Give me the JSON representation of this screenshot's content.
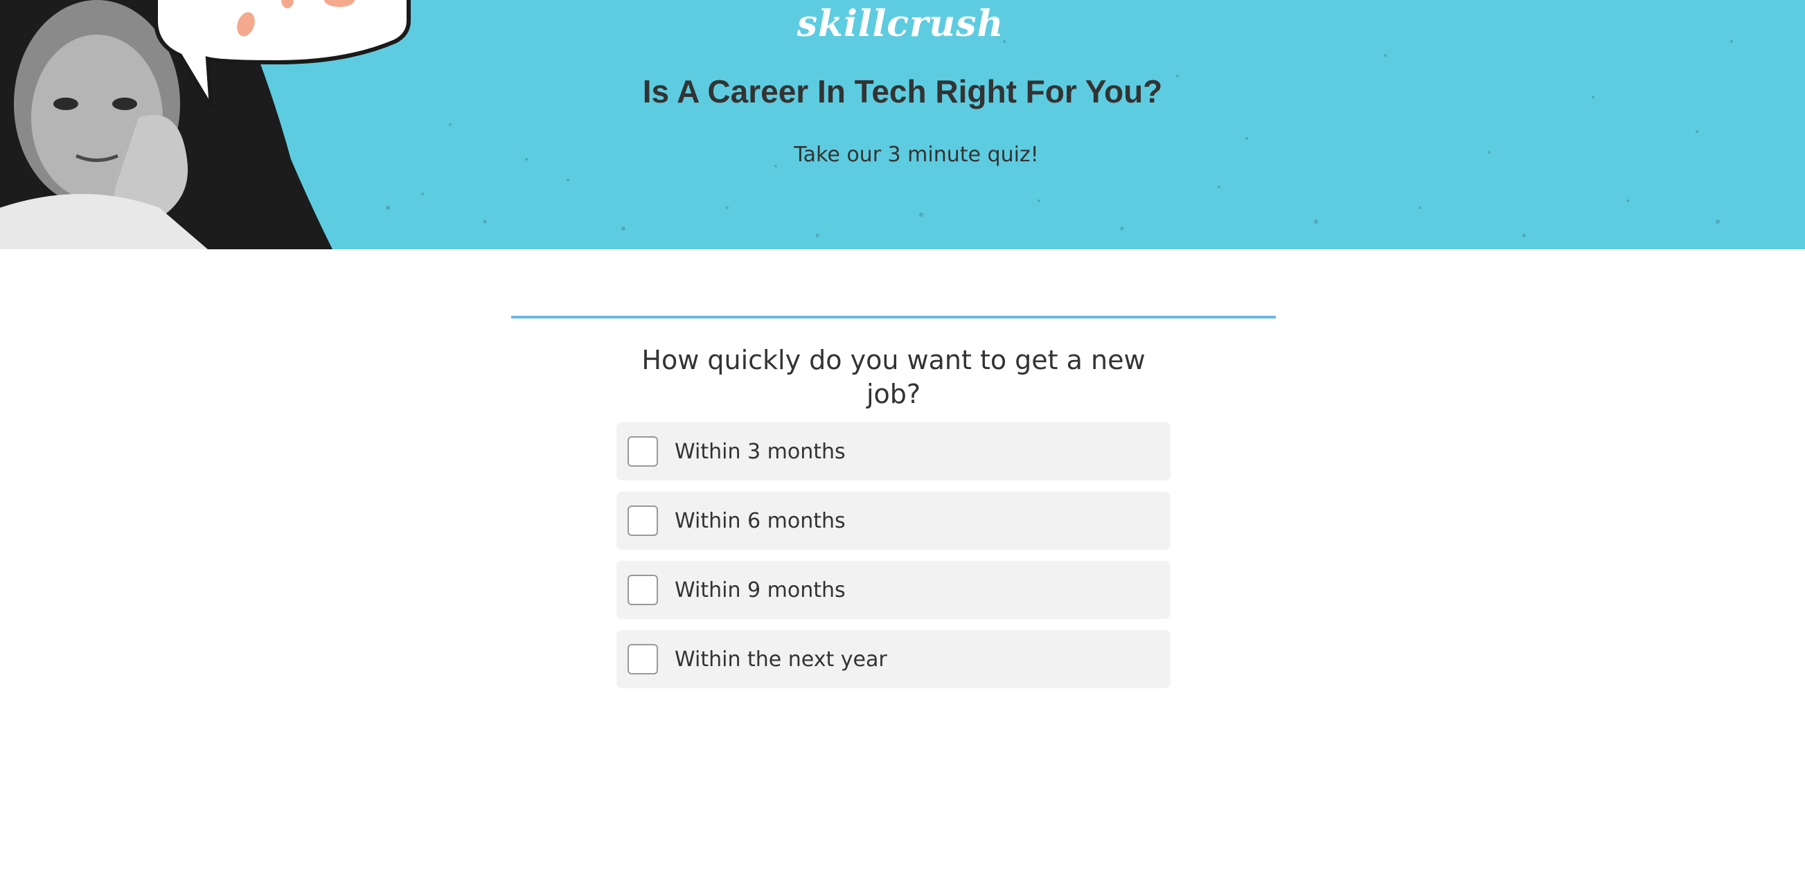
{
  "hero": {
    "logo_text": "skillcrush",
    "title": "Is A Career In Tech Right For You?",
    "subtitle": "Take our 3 minute quiz!"
  },
  "quiz": {
    "progress_fraction": 1.0,
    "question": "How quickly do you want to get a new job?",
    "options": [
      {
        "label": "Within 3 months",
        "checked": false
      },
      {
        "label": "Within 6 months",
        "checked": false
      },
      {
        "label": "Within 9 months",
        "checked": false
      },
      {
        "label": "Within the next year",
        "checked": false
      }
    ]
  },
  "colors": {
    "hero_background": "#5ecce0",
    "progress_bar": "#6cb8e6",
    "option_background": "#f2f2f2",
    "text": "#333333"
  }
}
